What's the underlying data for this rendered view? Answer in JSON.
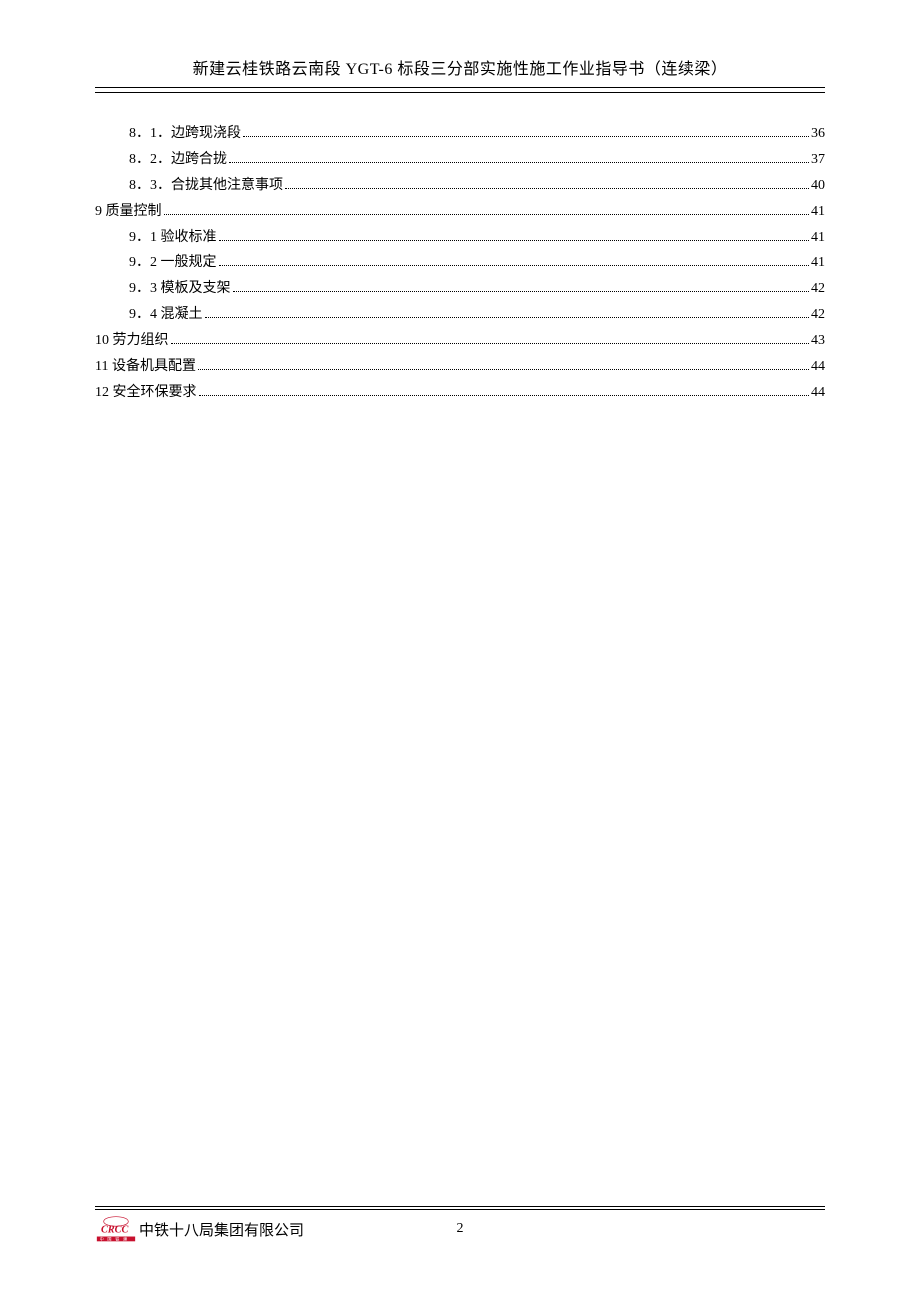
{
  "header": {
    "title": "新建云桂铁路云南段 YGT-6 标段三分部实施性施工作业指导书（连续梁）"
  },
  "toc": [
    {
      "label": "8．1．边跨现浇段",
      "page": "36",
      "indent": 1
    },
    {
      "label": "8．2．边跨合拢",
      "page": "37",
      "indent": 1
    },
    {
      "label": "8．3．合拢其他注意事项",
      "page": "40",
      "indent": 1
    },
    {
      "label": "9 质量控制",
      "page": "41",
      "indent": 0
    },
    {
      "label": "9．1 验收标准",
      "page": "41",
      "indent": 1
    },
    {
      "label": "9．2 一般规定",
      "page": "41",
      "indent": 1
    },
    {
      "label": "9．3 模板及支架",
      "page": "42",
      "indent": 1
    },
    {
      "label": "9．4 混凝土",
      "page": "42",
      "indent": 1
    },
    {
      "label": "10 劳力组织",
      "page": "43",
      "indent": 0
    },
    {
      "label": "11 设备机具配置",
      "page": "44",
      "indent": 0
    },
    {
      "label": "12 安全环保要求",
      "page": "44",
      "indent": 0
    }
  ],
  "footer": {
    "logo_top": "CRCC",
    "logo_bottom": "中 国 铁 建",
    "company": "中铁十八局集团有限公司",
    "page_number": "2"
  }
}
